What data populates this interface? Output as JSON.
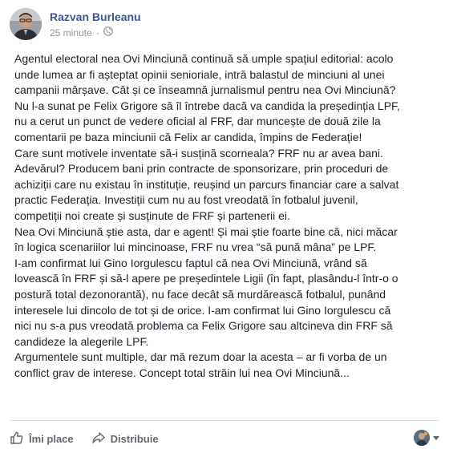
{
  "post": {
    "author": "Razvan Burleanu",
    "timestamp": "25 minute",
    "separator": "·",
    "privacy_icon": "globe-icon",
    "lines": [
      "Agentul electoral nea Ovi Minciună continuă să umple spațiul editorial: acolo",
      "unde lumea ar fi așteptat opinii senioriale, intră balastul de minciuni al unei",
      "campanii mârșave. Cât și ce înseamnă jurnalismul pentru nea Ovi Minciună?",
      "Nu l-a sunat pe Felix Grigore să îl întrebe dacă va candida la președinția LPF,",
      "nu a cerut un punct de vedere oficial al FRF, dar muncește de două zile la",
      "comentarii pe baza minciunii că Felix ar candida, împins de Federație!",
      "Care sunt motivele inventate să-i susțină scorneala? FRF nu ar avea bani.",
      "Adevărul? Producem bani prin contracte de sponsorizare, prin proceduri de",
      "achiziții care nu existau în instituție, reușind un parcurs financiar care a salvat",
      "practic Federația. Investiții cum nu au fost vreodată în fotbalul juvenil,",
      "competiții noi create și susținute de FRF și partenerii ei.",
      "Nea Ovi Minciună știe asta, dar e agent! Și mai știe foarte bine că, nici măcar",
      "în logica scenariilor lui mincinoase, FRF nu vrea “să pună mâna” pe LPF.",
      "I-am confirmat lui Gino Iorgulescu faptul că nea Ovi Minciună, vrând să",
      "lovească în FRF și să-l apere pe președintele Ligii (în fapt, plasându-l într-o o",
      "postură total dezonorantă), nu face decât să murdărească fotbalul, punând",
      "interesele lui dincolo de tot și de orice. I-am confirmat lui Gino Iorgulescu că",
      "nici nu s-a pus vreodată problema ca Felix Grigore sau altcineva din FRF să",
      "candideze la alegerile LPF.",
      "Argumentele sunt multiple, dar mă rezum doar la acesta – ar fi vorba de un",
      "conflict grav de interese. Concept total străin lui nea Ovi Minciună..."
    ]
  },
  "actions": {
    "like_label": "Îmi place",
    "like_icon": "thumbs-up-icon",
    "share_label": "Distribuie",
    "share_icon": "share-arrow-icon"
  },
  "colors": {
    "author": "#385898",
    "meta": "#90949c",
    "text": "#1d2129",
    "action": "#606770",
    "divider": "#dadde1"
  }
}
